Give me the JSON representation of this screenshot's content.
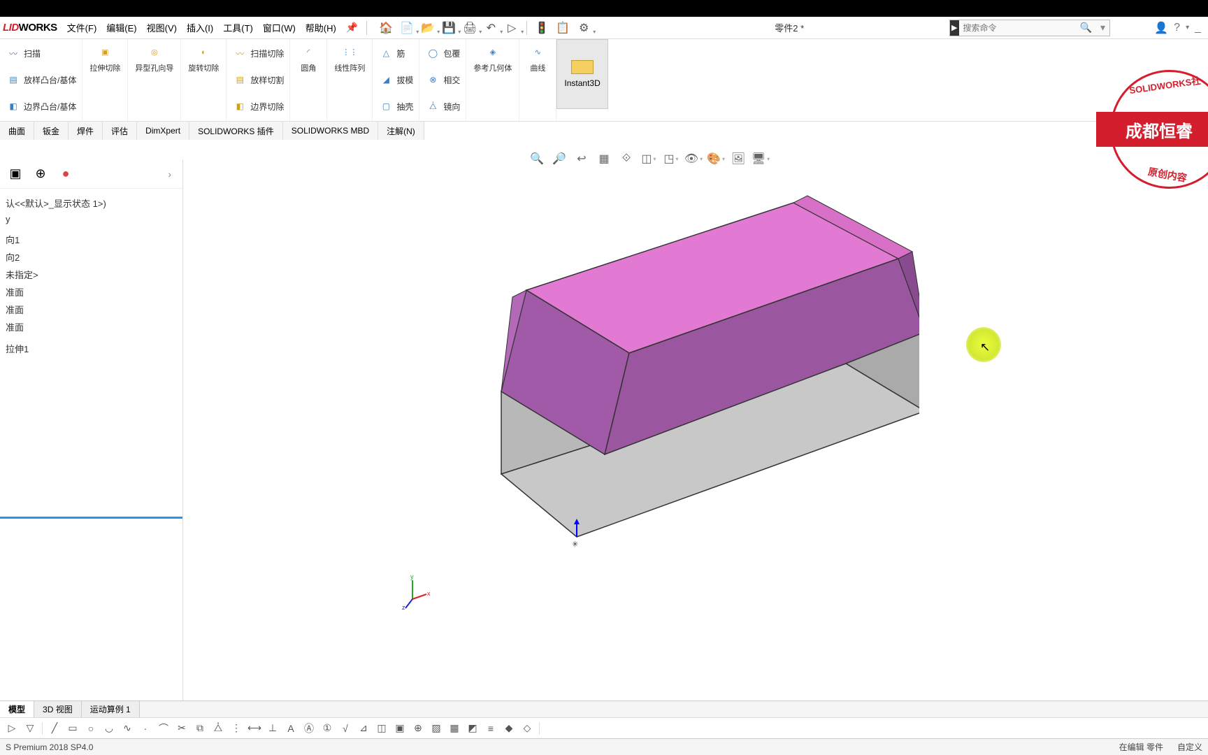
{
  "app": {
    "logo1": "LID",
    "logo2": "WORKS"
  },
  "menus": [
    "文件(F)",
    "编辑(E)",
    "视图(V)",
    "插入(I)",
    "工具(T)",
    "窗口(W)",
    "帮助(H)"
  ],
  "doc_title": "零件2 *",
  "search_placeholder": "搜索命令",
  "ribbon": {
    "sweep": "扫描",
    "loft": "放样凸台/基体",
    "boundary": "边界凸台/基体",
    "extcut": "拉伸切除",
    "holewiz": "异型孔向导",
    "revcut": "旋转切除",
    "sweepcut": "扫描切除",
    "loftcut": "放样切割",
    "boundarycut": "边界切除",
    "fillet": "圆角",
    "linpat": "线性阵列",
    "rib": "筋",
    "draft": "拔模",
    "shell": "抽壳",
    "wrap": "包覆",
    "intersect": "相交",
    "mirror": "镜向",
    "refgeo": "参考几何体",
    "curves": "曲线",
    "instant3d": "Instant3D"
  },
  "cmdtabs": [
    "曲面",
    "钣金",
    "焊件",
    "评估",
    "DimXpert",
    "SOLIDWORKS 插件",
    "SOLIDWORKS MBD",
    "注解(N)"
  ],
  "tree": {
    "root": "认<<默认>_显示状态 1>)",
    "items": [
      "y",
      "",
      "向1",
      "向2",
      "未指定>",
      "准面",
      "准面",
      "准面",
      "",
      "拉伸1"
    ]
  },
  "bottabs": [
    "模型",
    "3D 视图",
    "运动算例 1"
  ],
  "status": {
    "version": "S Premium 2018 SP4.0",
    "edit": "在编辑 零件",
    "custom": "自定义"
  },
  "stamp": {
    "top": "SOLIDWORKS社",
    "mid": "成都恒睿",
    "bot": "原创内容"
  }
}
